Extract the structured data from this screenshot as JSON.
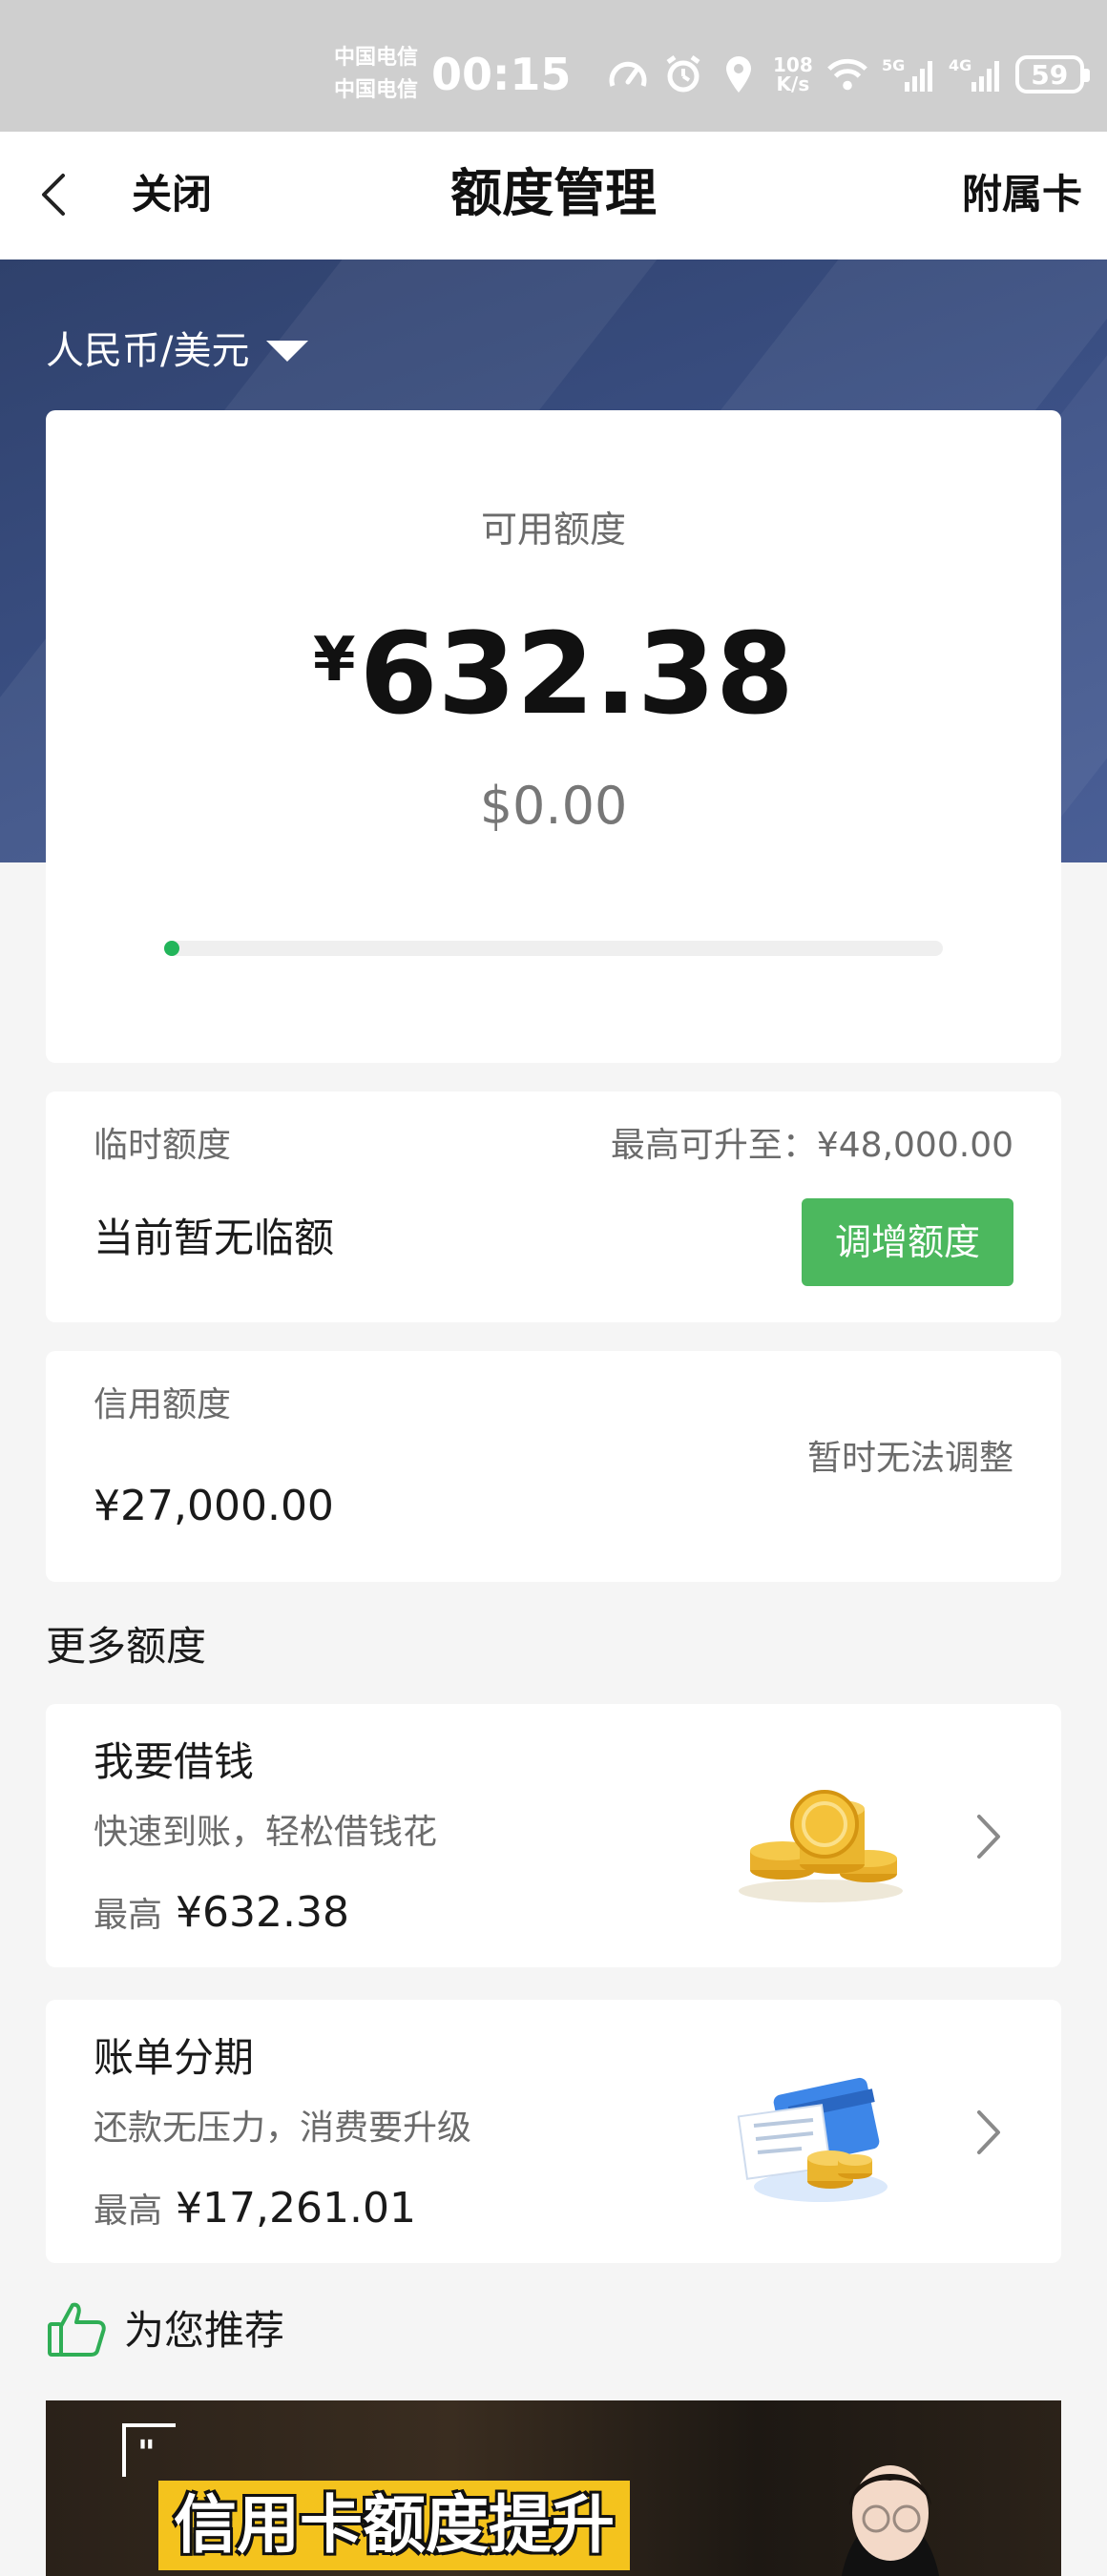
{
  "status_bar": {
    "carrier_1": "中国电信",
    "carrier_2": "中国电信",
    "time": "00:15",
    "net_speed_value": "108",
    "net_speed_unit": "K/s",
    "net_1": "5G",
    "net_2": "4G",
    "battery": "59"
  },
  "nav": {
    "close_label": "关闭",
    "title": "额度管理",
    "right_label": "附属卡"
  },
  "currency_selector": "人民币/美元",
  "available": {
    "label": "可用额度",
    "symbol": "¥",
    "amount": "632.38",
    "usd": "$0.00",
    "progress_fraction": 0.02
  },
  "temporary": {
    "title": "临时额度",
    "max_label": "最高可升至：¥48,000.00",
    "status": "当前暂无临额",
    "button_label": "调增额度"
  },
  "credit": {
    "title": "信用额度",
    "amount": "¥27,000.00",
    "note": "暂时无法调整"
  },
  "more_section_title": "更多额度",
  "promos": [
    {
      "title": "我要借钱",
      "subtitle": "快速到账，轻松借钱花",
      "max_label": "最高",
      "max_value": "¥632.38",
      "icon": "gold-coins-icon"
    },
    {
      "title": "账单分期",
      "subtitle": "还款无压力，消费要升级",
      "max_label": "最高",
      "max_value": "¥17,261.01",
      "icon": "bill-card-coins-icon"
    }
  ],
  "recommend": {
    "label": "为您推荐",
    "icon": "thumbs-up-icon"
  },
  "banner": {
    "headline": "信用卡额度提升"
  },
  "colors": {
    "accent_green": "#4cb85e",
    "progress_green": "#22b55a",
    "hero_blue": "#3c5186"
  }
}
